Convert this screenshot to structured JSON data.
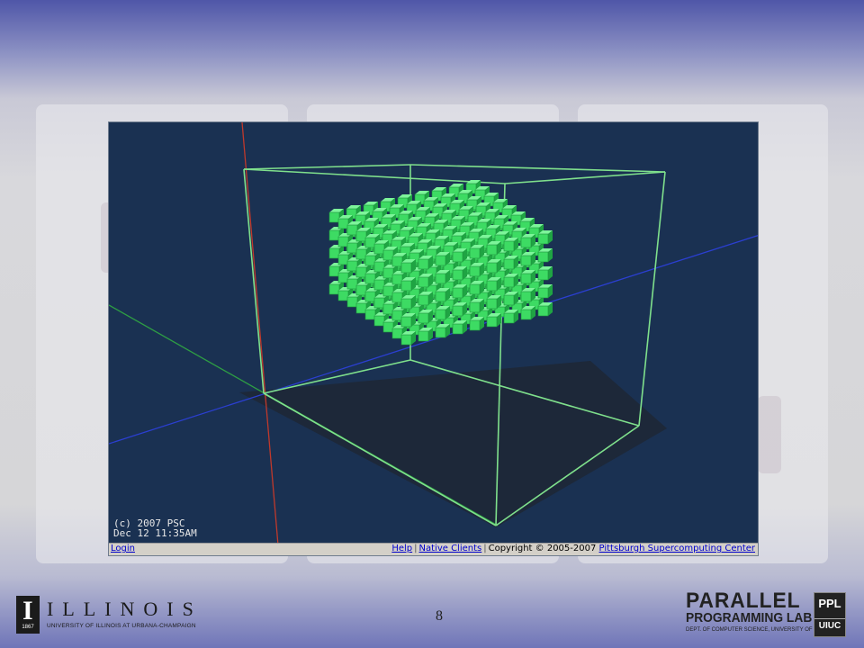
{
  "viewer": {
    "stamp_line1": "(c) 2007 PSC",
    "stamp_line2": "Dec 12 11:35AM",
    "status": {
      "login": "Login",
      "help": "Help",
      "native_clients": "Native Clients",
      "copyright": "Copyright © 2005-2007",
      "psc_link": "Pittsburgh Supercomputing Center"
    }
  },
  "slide": {
    "page_number": "8"
  },
  "logos": {
    "illinois_word": "ILLINOIS",
    "illinois_year": "1867",
    "illinois_sub": "UNIVERSITY OF ILLINOIS AT URBANA-CHAMPAIGN",
    "ppl_line1": "PARALLEL",
    "ppl_line2": "PROGRAMMING LAB",
    "ppl_line3": "DEPT. OF COMPUTER SCIENCE, UNIVERSITY OF ILLINOIS",
    "ppl_box_top": "PPL",
    "ppl_box_bottom": "UIUC"
  },
  "colors": {
    "viewer_bg": "#1a3152",
    "box_wire": "#7fe08c",
    "cube_face": "#3ddb63",
    "axis_red": "#c0392b",
    "axis_blue": "#2b3fd1",
    "axis_green": "#2e9e44"
  }
}
